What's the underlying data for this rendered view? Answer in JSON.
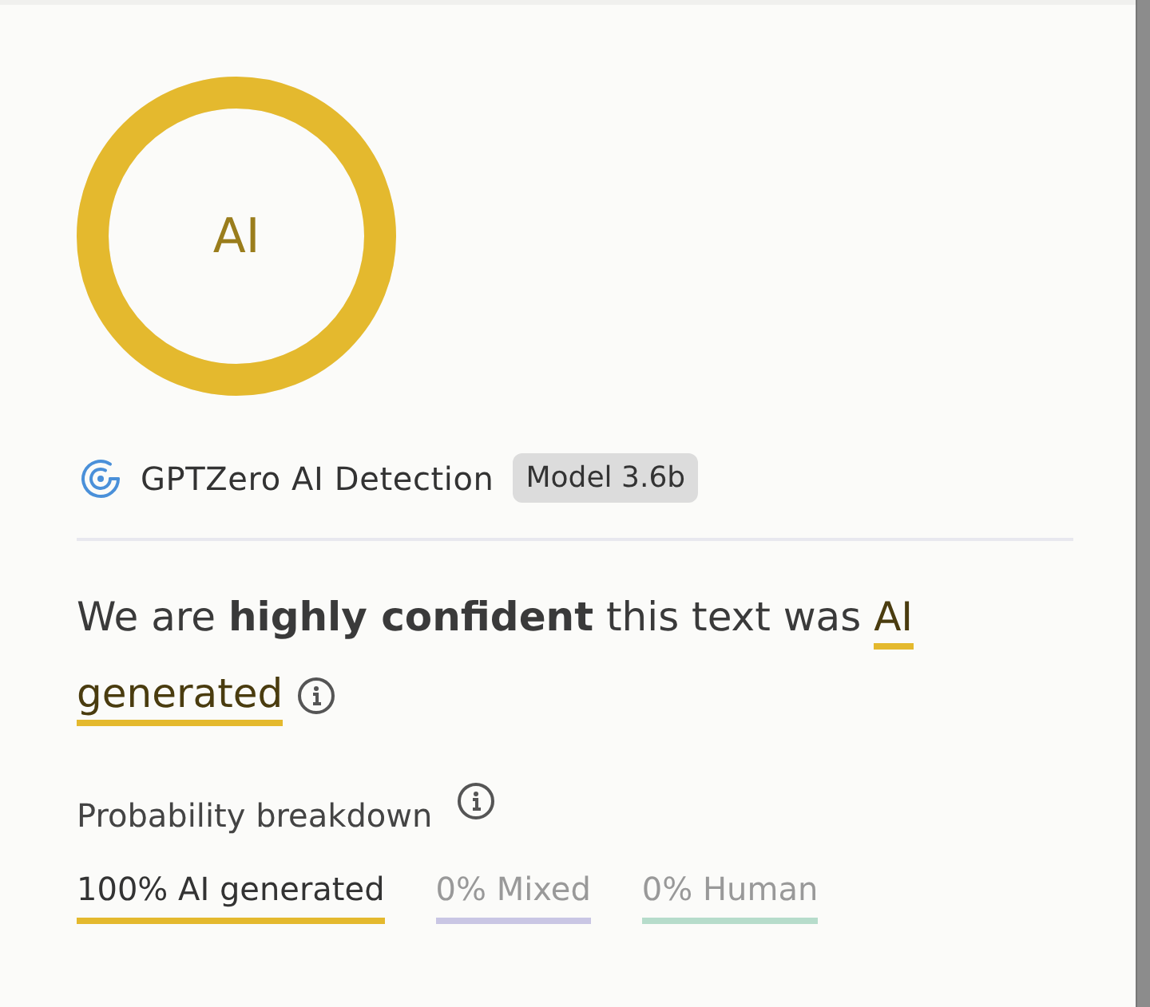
{
  "score_ring": {
    "label": "AI",
    "level": 1
  },
  "detector": {
    "name": "GPTZero AI Detection",
    "model": "Model 3.6b"
  },
  "verdict": {
    "lead": "We are **highly confident** this text was",
    "result": [
      "AI",
      "generated"
    ]
  },
  "breakdown": {
    "title": "Probability breakdown",
    "items": [
      {
        "label": "100% AI generated",
        "selected": true,
        "color": "#e4b92e"
      },
      {
        "label": "0% Mixed",
        "selected": false,
        "color": "#c9c6e4"
      },
      {
        "label": "0% Human",
        "selected": false,
        "color": "#b6dccb"
      }
    ]
  }
}
